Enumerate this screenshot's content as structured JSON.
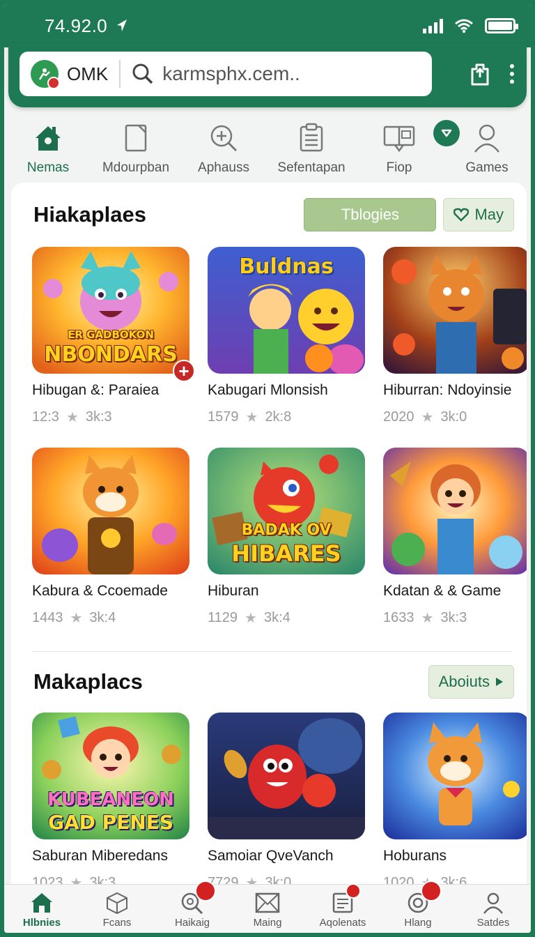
{
  "status_bar": {
    "time": "74.92.0"
  },
  "browser": {
    "site_name": "OMK",
    "url": "karmsphx.cem.."
  },
  "categories": [
    {
      "label": "Nemas",
      "icon": "home-icon",
      "active": true
    },
    {
      "label": "Mdourpban",
      "icon": "tablet-icon",
      "active": false
    },
    {
      "label": "Aphauss",
      "icon": "search-icon",
      "active": false
    },
    {
      "label": "Sefentapan",
      "icon": "clipboard-icon",
      "active": false
    },
    {
      "label": "Fiop",
      "icon": "monitor-icon",
      "active": false
    },
    {
      "label": "Games",
      "icon": "user-icon",
      "active": false
    }
  ],
  "section1": {
    "title": "Hiakaplaes",
    "primary_button": "Tblogies",
    "secondary_button": "May",
    "items": [
      {
        "title": "Hibugan &: Paraiea",
        "count": "12:3",
        "rating": "3k:3",
        "thumb_text": "NBONDARS",
        "thumb_subtext": "ER GADBOKON"
      },
      {
        "title": "Kabugari Mlonsish",
        "count": "1579",
        "rating": "2k:8",
        "thumb_text": "Buldnas"
      },
      {
        "title": "Hiburran: Ndoyinsie",
        "count": "2020",
        "rating": "3k:0"
      },
      {
        "title": "Kabura & Ccoemade",
        "count": "1443",
        "rating": "3k:4"
      },
      {
        "title": "Hiburan",
        "count": "1129",
        "rating": "3k:4",
        "thumb_text": "HIBARES",
        "thumb_subtext": "BADAK OV"
      },
      {
        "title": "Kdatan & & Game",
        "count": "1633",
        "rating": "3k:3"
      }
    ]
  },
  "section2": {
    "title": "Makaplacs",
    "button": "Aboiuts",
    "items": [
      {
        "title": "Saburan Miberedans",
        "count": "1023",
        "rating": "3k:3",
        "thumb_text": "GAD PENES",
        "thumb_subtext": "KUBEANEON"
      },
      {
        "title": "Samoiar QveVanch",
        "count": "7729",
        "rating": "3k:0"
      },
      {
        "title": "Hoburans",
        "count": "1020",
        "rating": "3k:6"
      }
    ]
  },
  "bottom_nav": [
    {
      "label": "Hlbnies",
      "icon": "home-icon",
      "active": true
    },
    {
      "label": "Fcans",
      "icon": "cube-icon",
      "active": false
    },
    {
      "label": "Haikaig",
      "icon": "search-icon",
      "active": false,
      "badge": true
    },
    {
      "label": "Maing",
      "icon": "mail-icon",
      "active": false
    },
    {
      "label": "Aqolenats",
      "icon": "document-icon",
      "active": false,
      "badge": true
    },
    {
      "label": "Hlang",
      "icon": "target-icon",
      "active": false,
      "badge": true
    },
    {
      "label": "Satdes",
      "icon": "user-icon",
      "active": false
    }
  ],
  "colors": {
    "brand": "#1d7a55",
    "accent_light": "#a8c890",
    "badge": "#d32020"
  }
}
